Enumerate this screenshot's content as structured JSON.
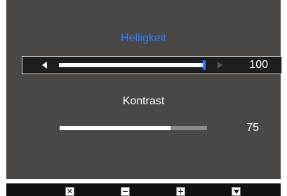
{
  "brightness": {
    "label": "Helligkeit",
    "value": "100",
    "level": 1.0
  },
  "contrast": {
    "label": "Kontrast",
    "value": "75",
    "level": 0.75
  },
  "keys": {
    "exit_symbol": "✕",
    "minus_symbol": "−",
    "plus_symbol": "+",
    "down_icon": "down-triangle-icon"
  },
  "colors": {
    "panel": "#4a4744",
    "selected": "#2f7bff",
    "track_fill": "#ffffff",
    "track_empty": "#8a8a8a"
  }
}
